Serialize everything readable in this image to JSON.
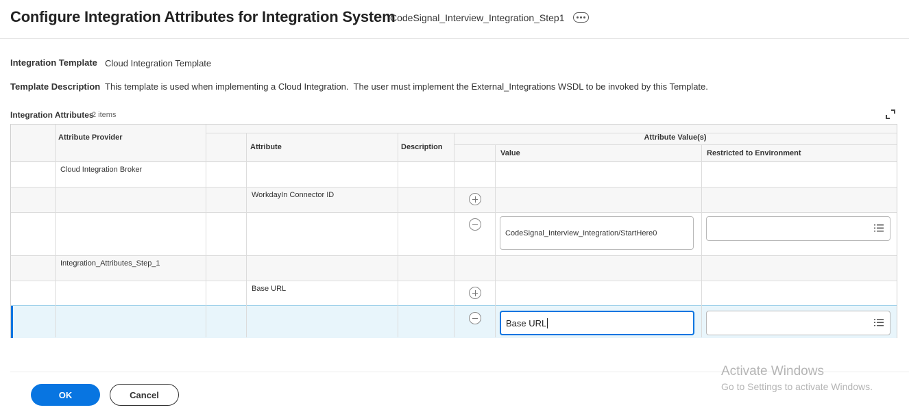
{
  "header": {
    "title": "Configure Integration Attributes for Integration System",
    "system_name": "CodeSignal_Interview_Integration_Step1"
  },
  "fields": {
    "template_label": "Integration Template",
    "template_value": "Cloud Integration Template",
    "description_label": "Template Description",
    "description_value": "This template is used when implementing a Cloud Integration.  The user must implement the External_Integrations WSDL to be invoked by this Template."
  },
  "section": {
    "title": "Integration Attributes",
    "count": "2 items"
  },
  "grid": {
    "headers": {
      "attribute_provider": "Attribute Provider",
      "attribute": "Attribute",
      "description": "Description",
      "attribute_values": "Attribute Value(s)",
      "value": "Value",
      "restricted": "Restricted to Environment"
    },
    "rows": [
      {
        "provider": "Cloud Integration Broker"
      },
      {
        "attribute": "WorkdayIn Connector ID"
      },
      {
        "value": "CodeSignal_Interview_Integration/StartHere0",
        "restricted": ""
      },
      {
        "provider": "Integration_Attributes_Step_1"
      },
      {
        "attribute": "Base URL"
      },
      {
        "value": "Base URL",
        "restricted": ""
      }
    ]
  },
  "buttons": {
    "ok": "OK",
    "cancel": "Cancel"
  },
  "watermark": {
    "title": "Activate Windows",
    "subtitle": "Go to Settings to activate Windows."
  },
  "icons": {
    "more": "ellipsis-icon",
    "expand": "expand-icon",
    "add": "plus-circle-icon",
    "remove": "minus-circle-icon",
    "prompt": "list-icon"
  },
  "colors": {
    "accent": "#0875e1",
    "selected_row": "#e8f5fb",
    "header_bg": "#f7f7f7"
  }
}
